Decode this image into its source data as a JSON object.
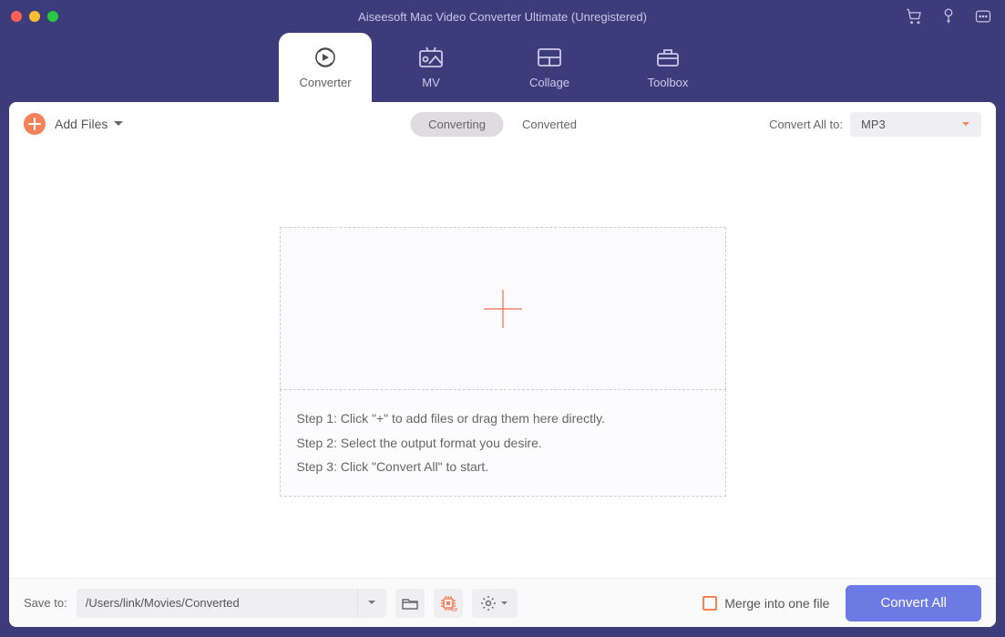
{
  "title": "Aiseesoft Mac Video Converter Ultimate (Unregistered)",
  "tabs": {
    "converter": "Converter",
    "mv": "MV",
    "collage": "Collage",
    "toolbox": "Toolbox"
  },
  "toolbar": {
    "add_files": "Add Files",
    "converting": "Converting",
    "converted": "Converted",
    "convert_all_to": "Convert All to:",
    "format_selected": "MP3"
  },
  "dropzone": {
    "step1": "Step 1: Click \"+\" to add files or drag them here directly.",
    "step2": "Step 2: Select the output format you desire.",
    "step3": "Step 3: Click \"Convert All\" to start."
  },
  "bottombar": {
    "save_to_label": "Save to:",
    "save_path": "/Users/link/Movies/Converted",
    "merge_label": "Merge into one file",
    "convert_all": "Convert All"
  }
}
